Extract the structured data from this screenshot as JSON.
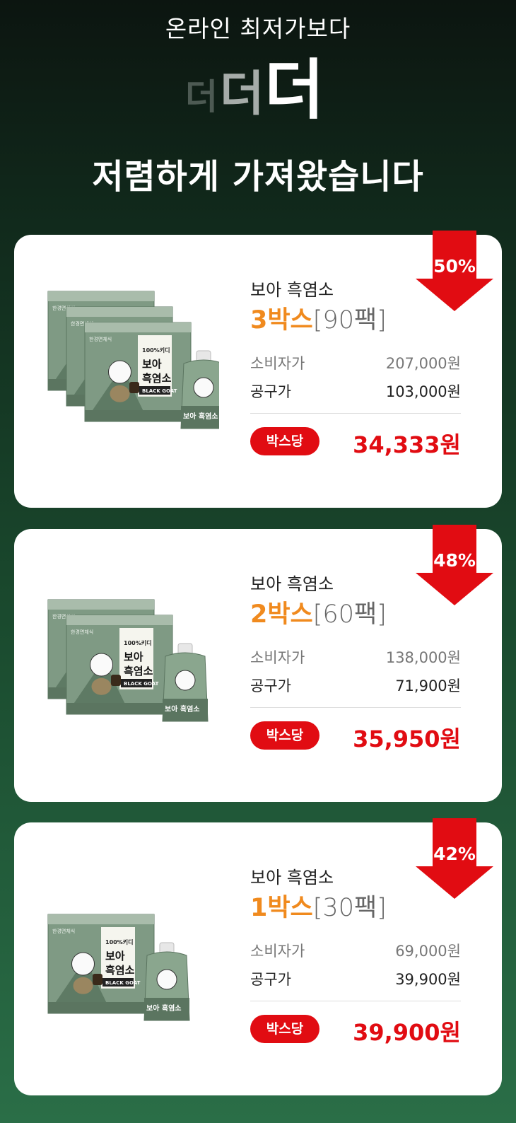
{
  "hero": {
    "line1": "온라인 최저가보다",
    "deo": [
      "더",
      "더",
      "더"
    ],
    "line3": "저렴하게 가져왔습니다"
  },
  "colors": {
    "accent_red": "#e10c12",
    "accent_orange": "#f08a1e",
    "box_green": "#6c8c72"
  },
  "offers": [
    {
      "discount": "50%",
      "name": "보아 흑염소",
      "box_count": "3박스",
      "pack_count": "[90팩]",
      "list_label": "소비자가",
      "list_price": "207,000원",
      "deal_label": "공구가",
      "deal_price": "103,000원",
      "per_box_label": "박스당",
      "per_box_price": "34,333원"
    },
    {
      "discount": "48%",
      "name": "보아 흑염소",
      "box_count": "2박스",
      "pack_count": "[60팩]",
      "list_label": "소비자가",
      "list_price": "138,000원",
      "deal_label": "공구가",
      "deal_price": "71,900원",
      "per_box_label": "박스당",
      "per_box_price": "35,950원"
    },
    {
      "discount": "42%",
      "name": "보아 흑염소",
      "box_count": "1박스",
      "pack_count": "[30팩]",
      "list_label": "소비자가",
      "list_price": "69,000원",
      "deal_label": "공구가",
      "deal_price": "39,900원",
      "per_box_label": "박스당",
      "per_box_price": "39,900원"
    }
  ],
  "product_art": {
    "brand_small": "한경면체식",
    "label_top": "100%키디",
    "label_title_1": "보아",
    "label_title_2": "흑염소",
    "label_band": "BLACK GOAT",
    "pouch_title": "보아 흑염소"
  }
}
